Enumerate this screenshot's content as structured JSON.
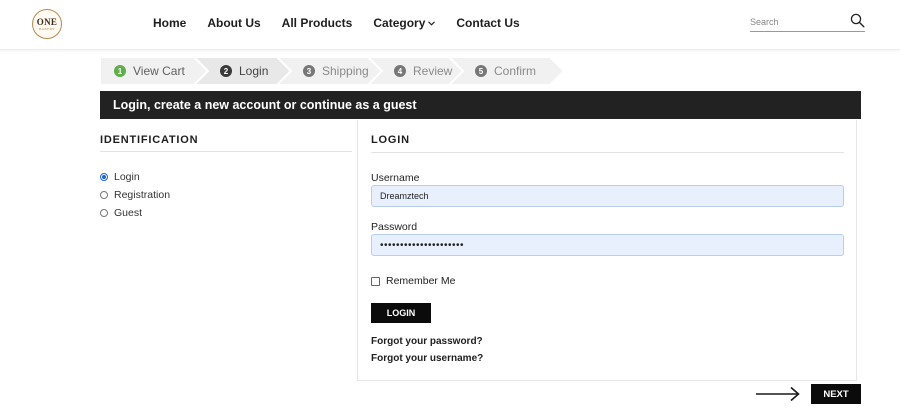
{
  "header": {
    "logo": {
      "main": "ONE",
      "sub": "BAKERY"
    },
    "nav": [
      "Home",
      "About Us",
      "All Products",
      "Category",
      "Contact Us"
    ],
    "search_placeholder": "Search"
  },
  "steps": [
    {
      "num": "1",
      "label": "View Cart",
      "state": "done"
    },
    {
      "num": "2",
      "label": "Login",
      "state": "active"
    },
    {
      "num": "3",
      "label": "Shipping",
      "state": "pending"
    },
    {
      "num": "4",
      "label": "Review",
      "state": "pending"
    },
    {
      "num": "5",
      "label": "Confirm",
      "state": "pending"
    }
  ],
  "banner": "Login, create a new account or continue as a guest",
  "identification": {
    "title": "IDENTIFICATION",
    "options": [
      "Login",
      "Registration",
      "Guest"
    ],
    "selected": "Login"
  },
  "login": {
    "title": "LOGIN",
    "username_label": "Username",
    "username_value": "Dreamztech",
    "password_label": "Password",
    "password_value": "dreamztech12345678901",
    "remember_label": "Remember Me",
    "button": "LOGIN",
    "forgot_password": "Forgot your password?",
    "forgot_username": "Forgot your username?"
  },
  "next_button": "NEXT",
  "colors": {
    "done": "#5fae4a",
    "active_num": "#3a3a3a",
    "pending_num": "#777777",
    "banner": "#222222",
    "button": "#0b0b0b",
    "input_bg": "#e8f0fe"
  }
}
